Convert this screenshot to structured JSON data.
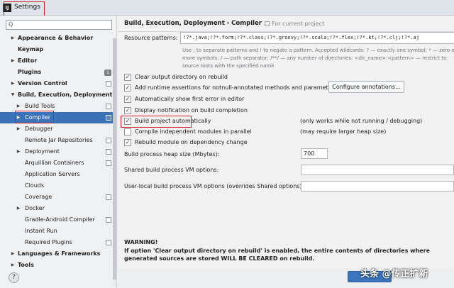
{
  "window": {
    "title": "Settings",
    "app_icon_text": "IJ"
  },
  "sidebar": {
    "search": {
      "value": "",
      "placeholder": "Q"
    },
    "items": [
      {
        "label": "Appearance & Behavior",
        "expand": "closed",
        "bold": true
      },
      {
        "label": "Keymap",
        "expand": "none",
        "bold": true
      },
      {
        "label": "Editor",
        "expand": "closed",
        "bold": true
      },
      {
        "label": "Plugins",
        "expand": "none",
        "bold": true,
        "badge": "1"
      },
      {
        "label": "Version Control",
        "expand": "closed",
        "bold": true,
        "project_icon": true
      },
      {
        "label": "Build, Execution, Deployment",
        "expand": "open",
        "bold": true
      },
      {
        "label": "Build Tools",
        "expand": "closed",
        "project_icon": true
      },
      {
        "label": "Compiler",
        "expand": "closed",
        "project_icon": true,
        "selected": true
      },
      {
        "label": "Debugger",
        "expand": "closed"
      },
      {
        "label": "Remote Jar Repositories",
        "expand": "none",
        "project_icon": true
      },
      {
        "label": "Deployment",
        "expand": "closed",
        "project_icon": true
      },
      {
        "label": "Arquillian Containers",
        "expand": "none",
        "project_icon": true
      },
      {
        "label": "Application Servers",
        "expand": "none"
      },
      {
        "label": "Clouds",
        "expand": "none"
      },
      {
        "label": "Coverage",
        "expand": "none",
        "project_icon": true
      },
      {
        "label": "Docker",
        "expand": "closed"
      },
      {
        "label": "Gradle-Android Compiler",
        "expand": "none",
        "project_icon": true
      },
      {
        "label": "Instant Run",
        "expand": "none"
      },
      {
        "label": "Required Plugins",
        "expand": "none",
        "project_icon": true
      },
      {
        "label": "Languages & Frameworks",
        "expand": "closed",
        "bold": true
      },
      {
        "label": "Tools",
        "expand": "closed",
        "bold": true
      }
    ],
    "help_label": "?"
  },
  "main": {
    "breadcrumb": "Build, Execution, Deployment  ›  Compiler",
    "scope_label": "For current project",
    "resource_patterns_label": "Resource patterns:",
    "resource_patterns_value": "!?*.java;!?*.form;!?*.class;!?*.groovy;!?*.scala;!?*.flex;!?*.kt;!?*.clj;!?*.aj",
    "hint": "Use ; to separate patterns and ! to negate a pattern. Accepted wildcards: ? — exactly one symbol; * — zero or more symbols; / — path separator; /**/ — any number of directories; <dir_name>:<pattern> — restrict to source roots with the specified name",
    "options": [
      {
        "label": "Clear output directory on rebuild",
        "checked": true
      },
      {
        "label": "Add runtime assertions for notnull-annotated methods and parameters",
        "checked": true
      },
      {
        "label": "Automatically show first error in editor",
        "checked": true
      },
      {
        "label": "Display notification on build completion",
        "checked": true
      },
      {
        "label": "Build project automatically",
        "checked": true,
        "note": "(only works while not running / debugging)"
      },
      {
        "label": "Compile independent modules in parallel",
        "checked": false,
        "note": "(may require larger heap size)"
      },
      {
        "label": "Rebuild module on dependency change",
        "checked": true
      }
    ],
    "configure_annotations_button": "Configure annotations...",
    "heap_size_label": "Build process heap size (Mbytes):",
    "heap_size_value": "700",
    "shared_vm_label": "Shared build process VM options:",
    "shared_vm_value": "",
    "user_vm_label": "User-local build process VM options (overrides Shared options):",
    "user_vm_value": "",
    "warning_title": "WARNING!",
    "warning_text": "If option 'Clear output directory on rebuild' is enabled, the entire contents of directories where generated sources are stored WILL BE CLEARED on rebuild."
  },
  "watermark": "头条 @传正扩新",
  "colors": {
    "selection": "#3c72b8",
    "highlight_box": "#d8202a"
  }
}
